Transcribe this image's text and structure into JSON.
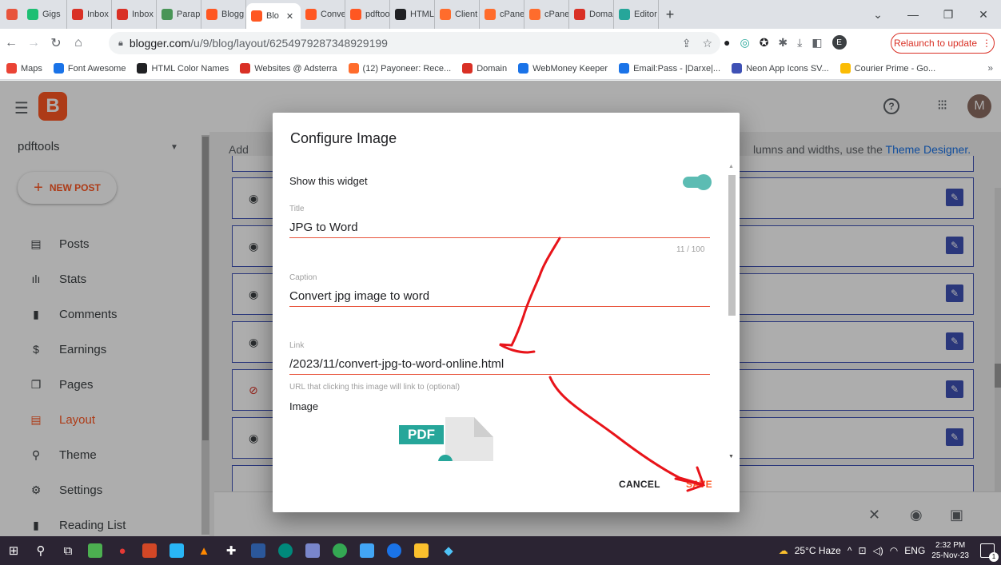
{
  "browser": {
    "tabs": [
      {
        "label": "",
        "icon": "chrome-ext-icon",
        "color": "#e8543c"
      },
      {
        "label": "Gigs",
        "icon": "fiverr-icon",
        "color": "#1dbf73"
      },
      {
        "label": "Inbox",
        "icon": "gmail-icon",
        "color": "#d93025"
      },
      {
        "label": "Inbox",
        "icon": "gmail-icon",
        "color": "#d93025"
      },
      {
        "label": "Paraph",
        "icon": "quillbot-icon",
        "color": "#499557"
      },
      {
        "label": "Blogg",
        "icon": "blogger-icon",
        "color": "#ff5722"
      },
      {
        "label": "Blo",
        "icon": "blogger-icon",
        "color": "#ff5722",
        "active": true
      },
      {
        "label": "Conve",
        "icon": "blogger-icon",
        "color": "#ff5722"
      },
      {
        "label": "pdftoo",
        "icon": "blogger-icon",
        "color": "#ff5722"
      },
      {
        "label": "HTML",
        "icon": "w3-icon",
        "color": "#202124"
      },
      {
        "label": "Client",
        "icon": "cpanel-icon",
        "color": "#ff6c2c"
      },
      {
        "label": "cPanel",
        "icon": "cpanel-icon",
        "color": "#ff6c2c"
      },
      {
        "label": "cPanel",
        "icon": "cpanel-icon",
        "color": "#ff6c2c"
      },
      {
        "label": "Domai",
        "icon": "domain-icon",
        "color": "#d93025"
      },
      {
        "label": "Editor",
        "icon": "editor-icon",
        "color": "#26a69a"
      }
    ],
    "url_host": "blogger.com",
    "url_path": "/u/9/blog/layout/6254979287348929199",
    "profile_letter": "E",
    "relaunch_label": "Relaunch to update",
    "bookmarks": [
      {
        "label": "Maps",
        "color": "#ea4335"
      },
      {
        "label": "Font Awesome",
        "color": "#1a73e8"
      },
      {
        "label": "HTML Color Names",
        "color": "#202124"
      },
      {
        "label": "Websites @ Adsterra",
        "color": "#d93025"
      },
      {
        "label": "(12) Payoneer: Rece...",
        "color": "#ff6c2c"
      },
      {
        "label": "Domain",
        "color": "#d93025"
      },
      {
        "label": "WebMoney Keeper",
        "color": "#1a73e8"
      },
      {
        "label": "Email:Pass - |Darxe|...",
        "color": "#1a73e8"
      },
      {
        "label": "Neon App Icons SV...",
        "color": "#3f51b5"
      },
      {
        "label": "Courier Prime - Go...",
        "color": "#fbbc04"
      }
    ]
  },
  "blogger": {
    "avatar_letter": "M",
    "blog_name": "pdftools",
    "new_post_label": "NEW POST",
    "nav": [
      {
        "label": "Posts",
        "icon": "posts-icon",
        "glyph": "▤"
      },
      {
        "label": "Stats",
        "icon": "stats-icon",
        "glyph": "ılı"
      },
      {
        "label": "Comments",
        "icon": "comments-icon",
        "glyph": "▮"
      },
      {
        "label": "Earnings",
        "icon": "earnings-icon",
        "glyph": "$"
      },
      {
        "label": "Pages",
        "icon": "pages-icon",
        "glyph": "❐"
      },
      {
        "label": "Layout",
        "icon": "layout-icon",
        "glyph": "▤",
        "active": true
      },
      {
        "label": "Theme",
        "icon": "theme-icon",
        "glyph": "⚲"
      },
      {
        "label": "Settings",
        "icon": "settings-icon",
        "glyph": "⚙"
      },
      {
        "label": "Reading List",
        "icon": "reading-list-icon",
        "glyph": "▮"
      }
    ],
    "hint_left": "Add",
    "hint_right": "lumns and widths, use the ",
    "theme_designer_link": "Theme Designer."
  },
  "dialog": {
    "title": "Configure Image",
    "show_widget_label": "Show this widget",
    "show_widget_on": true,
    "title_caption": "Title",
    "title_value": "JPG to Word",
    "title_counter": "11 / 100",
    "caption_caption": "Caption",
    "caption_value": "Convert jpg image to word",
    "link_caption": "Link",
    "link_value": "/2023/11/convert-jpg-to-word-online.html",
    "link_helper": "URL that clicking this image will link to (optional)",
    "image_label": "Image",
    "pdf_badge": "PDF",
    "cancel_label": "CANCEL",
    "save_label": "SAVE"
  },
  "taskbar": {
    "weather": "25°C  Haze",
    "lang": "ENG",
    "time": "2:32 PM",
    "date": "25-Nov-23",
    "notification_count": "1"
  },
  "colors": {
    "accent": "#ff5722",
    "teal": "#26a69a",
    "widget_border": "#3f51b5",
    "annotation_red": "#e8141a"
  }
}
